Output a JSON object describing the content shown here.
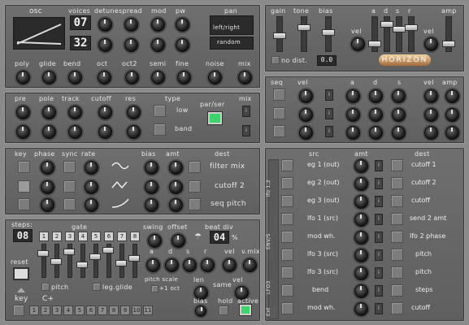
{
  "osc": {
    "title": "osc",
    "voices_label": "voices",
    "voices_value": "07",
    "oct_value": "32",
    "detune_label": "detune",
    "spread_label": "spread",
    "mod_label": "mod",
    "pw_label": "pw",
    "pan_label": "pan",
    "pan_mode": "left/right",
    "pan_random": "random",
    "poly_label": "poly",
    "glide_label": "glide",
    "bend_label": "bend",
    "oct_label": "oct",
    "oct2_label": "oct2",
    "semi_label": "semi",
    "fine_label": "fine",
    "noise_label": "noise",
    "mix_label": "mix"
  },
  "amp": {
    "gain_label": "gain",
    "tone_label": "tone",
    "bias_label": "bias",
    "no_dist_label": "no dist.",
    "bias_value": "0.0",
    "vel_label": "vel",
    "a_label": "a",
    "d_label": "d",
    "s_label": "s",
    "r_label": "r",
    "amp_label": "amp",
    "vel2_label": "vel",
    "logo": "HORIZON"
  },
  "filter": {
    "pre_label": "pre",
    "pole_label": "pole",
    "track_label": "track",
    "cutoff_label": "cutoff",
    "res_label": "res",
    "type_label": "type",
    "type_low": "low",
    "type_band": "band",
    "parser_label": "par/ser",
    "mix_label": "mix"
  },
  "seqenv": {
    "seq_label": "seq",
    "vel_label": "vel",
    "a_label": "a",
    "d_label": "d",
    "s_label": "s",
    "r_label": "r",
    "vel2_label": "vel",
    "amp_label": "amp"
  },
  "lfo": {
    "key_label": "key",
    "phase_label": "phase",
    "sync_label": "sync",
    "rate_label": "rate",
    "bias_label": "bias",
    "amt_label": "amt",
    "dest_label": "dest",
    "dests": [
      "filter mix",
      "cutoff 2",
      "seq pitch"
    ]
  },
  "mod": {
    "src_label": "src",
    "amt_label": "amt",
    "dest_label": "dest",
    "side_labels": [
      "lfo 1,2",
      "lfo 1,2",
      "ENV/S",
      "LFO3",
      "Ext"
    ],
    "rows": [
      {
        "src": "eg 1 (out)",
        "dest": "cutoff 1"
      },
      {
        "src": "eg 2 (out)",
        "dest": "cutoff 2"
      },
      {
        "src": "eg 3 (out)",
        "dest": "cutoff"
      },
      {
        "src": "lfo 1 (src)",
        "dest": "send 2 amt"
      },
      {
        "src": "mod wh.",
        "dest": "lfo 2 phase"
      },
      {
        "src": "lfo 3 (src)",
        "dest": "pitch"
      },
      {
        "src": "lfo 3 (src)",
        "dest": "pitch"
      },
      {
        "src": "bend",
        "dest": "steps"
      },
      {
        "src": "mod wh.",
        "dest": "cutoff"
      }
    ]
  },
  "seq": {
    "steps_label": "steps:",
    "steps_value": "08",
    "gate_label": "gate",
    "step_nums": [
      "1",
      "2",
      "3",
      "4",
      "5",
      "6",
      "7",
      "8"
    ],
    "swing_label": "swing",
    "offset_label": "offset",
    "beat_div_label": "beat div",
    "beat_div_value": "04",
    "beat_div_unit": "%",
    "reset_label": "reset",
    "pitch_label": "pitch",
    "leg_glide_label": "leg.glide",
    "a_label": "a",
    "d_label": "d",
    "s_label": "s",
    "r_label": "r",
    "vel_label": "vel",
    "vmix_label": "v.mix",
    "pitch_scale_label": "pitch scale",
    "oct_plus_label": "+1 oct",
    "len_label": "len",
    "same_label": "same",
    "vel2_label": "vel",
    "key_label": "key",
    "key_value": "C+",
    "key_nums": [
      "1",
      "2",
      "3",
      "4",
      "5",
      "6",
      "7",
      "8",
      "9",
      "10",
      "11"
    ],
    "bias_label": "bias",
    "hold_label": "hold",
    "active_label": "active"
  }
}
